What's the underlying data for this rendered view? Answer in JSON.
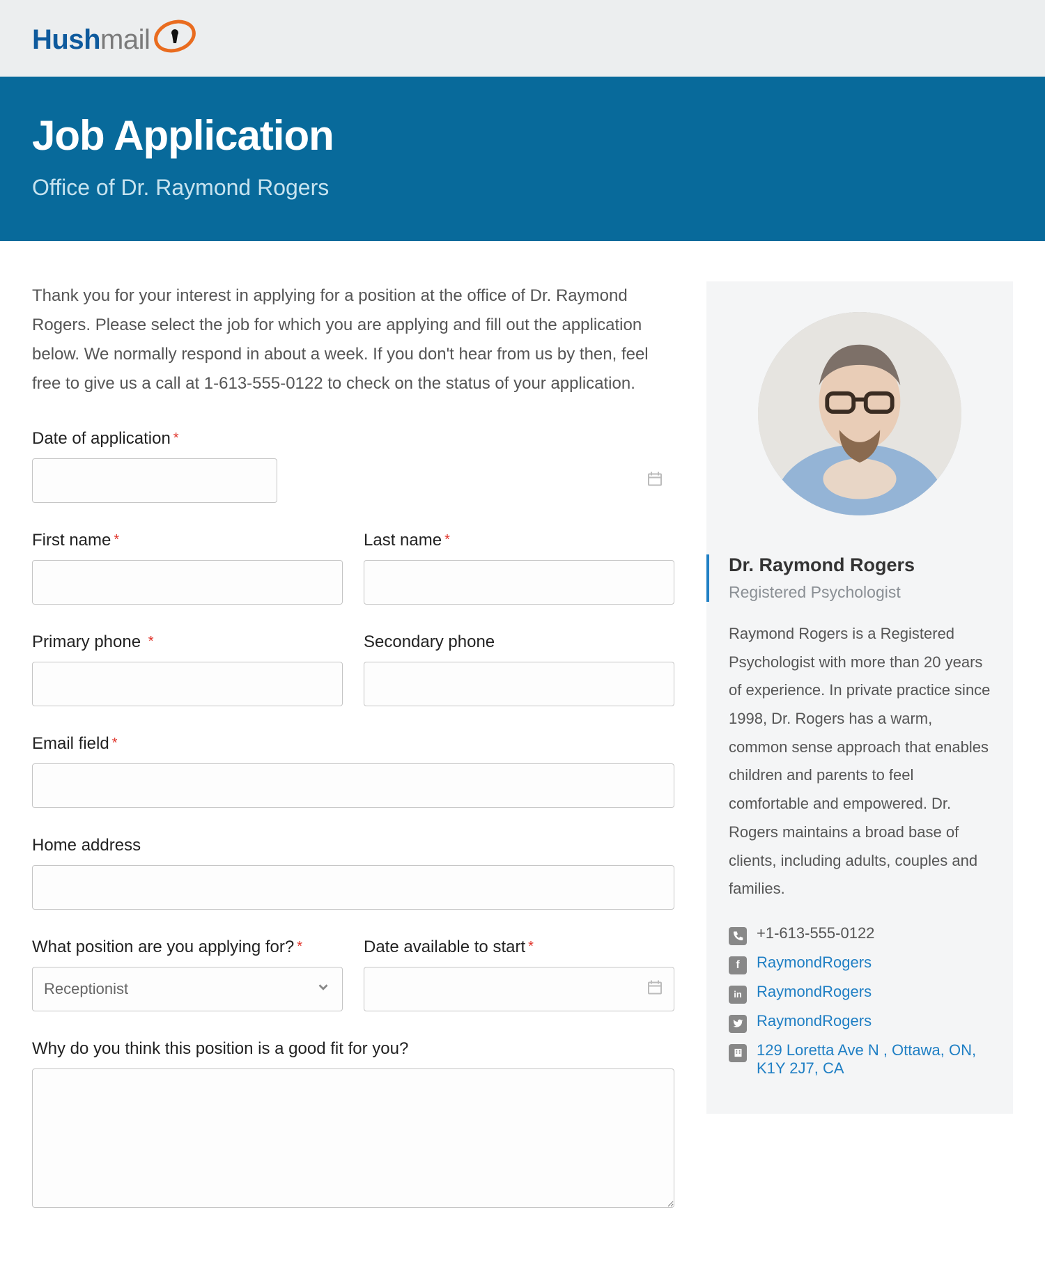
{
  "brand": {
    "part1": "Hush",
    "part2": "mail"
  },
  "hero": {
    "title": "Job Application",
    "subtitle": "Office of Dr. Raymond Rogers"
  },
  "intro": "Thank you for your interest in applying for a position at the office of Dr. Raymond Rogers. Please select the job for which you are applying and fill out the application below. We normally respond in about a week. If you don't hear from us by then, feel free to give us a call at 1-613-555-0122 to check on the status of your application.",
  "labels": {
    "date_of_application": "Date of application",
    "first_name": "First name",
    "last_name": "Last name",
    "primary_phone": "Primary phone",
    "secondary_phone": "Secondary phone",
    "email": "Email field",
    "home_address": "Home address",
    "position": "What position are you applying for?",
    "date_available": "Date available to start",
    "good_fit": "Why do you think this position is a good fit for you?"
  },
  "required_mark": "*",
  "position_selected": "Receptionist",
  "sidebar": {
    "name": "Dr. Raymond Rogers",
    "title": "Registered Psychologist",
    "bio": "Raymond Rogers is a Registered Psychologist with more than 20 years of experience. In private practice since 1998, Dr. Rogers has a warm, common sense approach that enables children and parents to feel comfortable and empowered. Dr. Rogers maintains a broad base of clients, including adults, couples and families.",
    "contacts": {
      "phone": "+1-613-555-0122",
      "facebook": "RaymondRogers",
      "linkedin": "RaymondRogers",
      "twitter": "RaymondRogers",
      "address": "129 Loretta Ave N , Ottawa, ON, K1Y 2J7, CA"
    }
  }
}
